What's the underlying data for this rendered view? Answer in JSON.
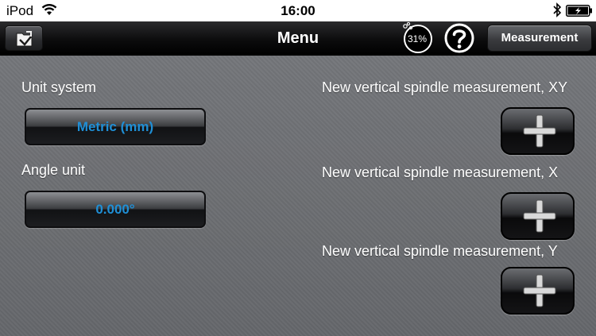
{
  "status_bar": {
    "carrier": "iPod",
    "time": "16:00",
    "wifi_icon": "wifi-icon",
    "bluetooth_icon": "bluetooth-icon",
    "battery_icon": "battery-charging-icon"
  },
  "nav": {
    "back_icon": "folder-back-icon",
    "title": "Menu",
    "progress_text": "31%",
    "progress_value": 0.31,
    "help_label": "?",
    "measurement_label": "Measurement"
  },
  "settings": {
    "unit_system_label": "Unit system",
    "unit_system_value": "Metric (mm)",
    "angle_unit_label": "Angle unit",
    "angle_unit_value": "0.000°"
  },
  "measurements": [
    {
      "label": "New vertical spindle measurement, XY",
      "icon": "plus-icon"
    },
    {
      "label": "New vertical spindle measurement, X",
      "icon": "plus-icon"
    },
    {
      "label": "New vertical spindle measurement, Y",
      "icon": "plus-icon"
    }
  ],
  "colors": {
    "accent_blue": "#1f8fd6",
    "background": "#6b6d71",
    "navbar": "#0c0c0d"
  }
}
